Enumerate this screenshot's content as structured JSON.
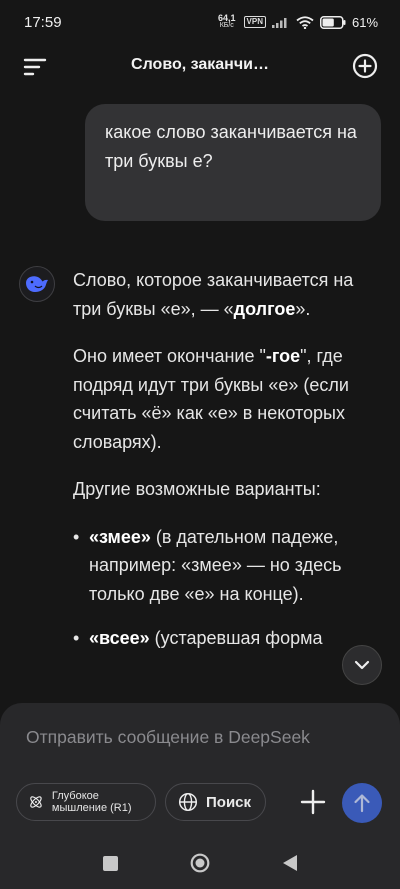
{
  "status_bar": {
    "time": "17:59",
    "net_speed_value": "64,1",
    "net_speed_unit": "КБ/с",
    "vpn": "VPN",
    "battery": "61",
    "battery_level": 0.61
  },
  "header": {
    "title": "Слово, заканчи…"
  },
  "user_message": {
    "text": "какое слово заканчивается на три буквы е?"
  },
  "assistant_message": {
    "p1_text": "Слово, которое заканчивается на три буквы «е», — «",
    "p1_bold": "долгое",
    "p1_end": "».",
    "p2_start": "Оно имеет окончание \"",
    "p2_bold": "-гое",
    "p2_end": "\", где подряд идут три буквы «е» (если считать «ё» как «е» в некоторых словарях).",
    "p3": "Другие возможные варианты:",
    "bullets": [
      {
        "bold": "«змее»",
        "text": " (в дательном падеже, например: «змее» — но здесь только две «е» на конце)."
      },
      {
        "bold": "«всее»",
        "text": " (устаревшая форма"
      }
    ]
  },
  "composer": {
    "placeholder": "Отправить сообщение в DeepSeek",
    "deep_think_label": "Глубокое мышление (R1)",
    "search_label": "Поиск"
  },
  "colors": {
    "background": "#161616",
    "bubble": "#333335",
    "accent": "#3a5ab8",
    "avatar": "#4d6bfe"
  },
  "icons": {
    "menu": "menu-icon",
    "new_chat": "new-chat-icon",
    "avatar": "deepseek-whale-icon",
    "scroll_down": "chevron-down-icon",
    "deep_think": "atom-icon",
    "search": "globe-icon",
    "plus": "plus-icon",
    "send": "arrow-up-icon"
  }
}
